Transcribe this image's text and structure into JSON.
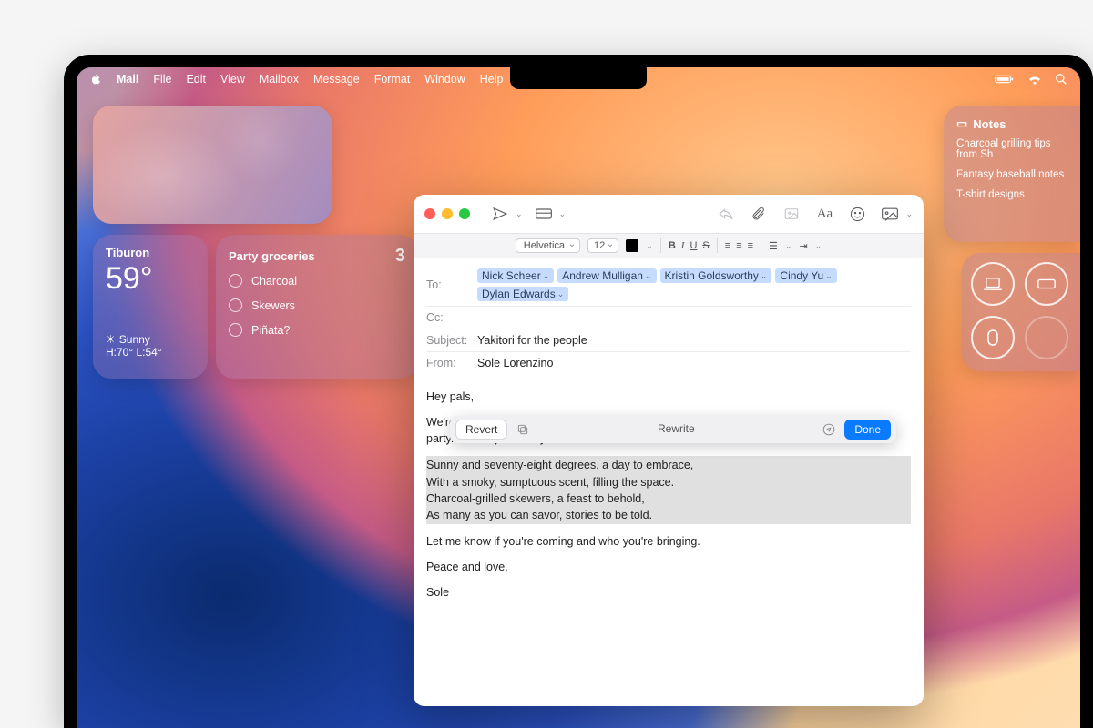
{
  "menubar": {
    "app": "Mail",
    "items": [
      "File",
      "Edit",
      "View",
      "Mailbox",
      "Message",
      "Format",
      "Window",
      "Help"
    ]
  },
  "weather": {
    "city": "Tiburon",
    "temp": "59°",
    "condition": "Sunny",
    "range": "H:70° L:54°"
  },
  "reminders": {
    "title": "Party groceries",
    "count": "3",
    "items": [
      "Charcoal",
      "Skewers",
      "Piñata?"
    ]
  },
  "notes": {
    "title": "Notes",
    "items": [
      "Charcoal grilling tips from Sh",
      "Fantasy baseball notes",
      "T-shirt designs"
    ]
  },
  "compose": {
    "format": {
      "font": "Helvetica",
      "size": "12"
    },
    "to_label": "To:",
    "cc_label": "Cc:",
    "subject_label": "Subject:",
    "from_label": "From:",
    "recipients": [
      "Nick Scheer",
      "Andrew Mulligan",
      "Kristin Goldsworthy",
      "Cindy Yu",
      "Dylan Edwards"
    ],
    "subject": "Yakitori for the people",
    "from": "Sole Lorenzino",
    "body": {
      "greeting": "Hey pals,",
      "p1": "We're finally settled into the new place, which means we're ready for a proper housewarming party. Please join us if you can tomorrow.",
      "poem1": "Sunny and seventy-eight degrees, a day to embrace,",
      "poem2": "With a smoky, sumptuous scent, filling the space.",
      "poem3": "Charcoal-grilled skewers, a feast to behold,",
      "poem4": "As many as you can savor, stories to be told.",
      "p2": "Let me know if you're coming and who you're bringing.",
      "sign1": "Peace and love,",
      "sign2": "Sole"
    }
  },
  "writingtools": {
    "revert": "Revert",
    "center": "Rewrite",
    "done": "Done"
  }
}
